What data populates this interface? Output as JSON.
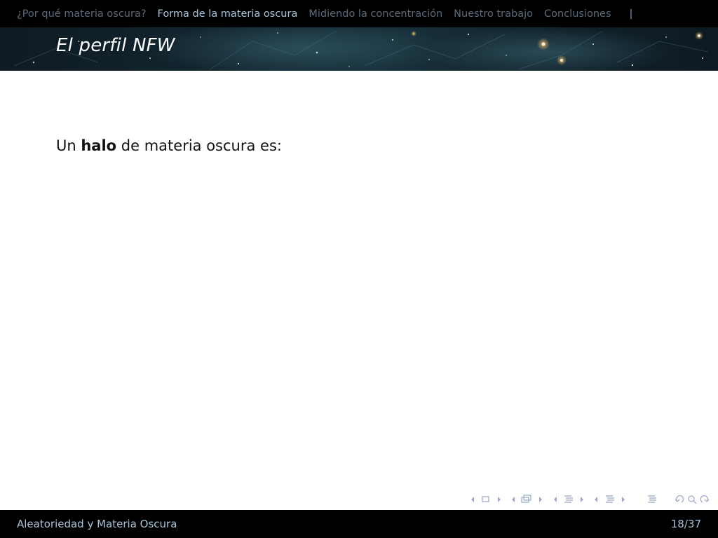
{
  "nav": {
    "items": [
      {
        "label": "¿Por qué materia oscura?",
        "active": false
      },
      {
        "label": "Forma de la materia oscura",
        "active": true
      },
      {
        "label": "Midiendo la concentración",
        "active": false
      },
      {
        "label": "Nuestro trabajo",
        "active": false
      },
      {
        "label": "Conclusiones",
        "active": false
      }
    ],
    "separator": "|"
  },
  "frame": {
    "title": "El perfil NFW"
  },
  "content": {
    "line_before": "Un ",
    "line_bold": "halo",
    "line_after": " de materia oscura es:"
  },
  "footer": {
    "title": "Aleatoriedad y Materia Oscura",
    "page": "18/37"
  },
  "colors": {
    "nav_inactive": "#5a6b78",
    "nav_active": "#a8c4d8",
    "nav_symbols": "#9aa8c8"
  }
}
